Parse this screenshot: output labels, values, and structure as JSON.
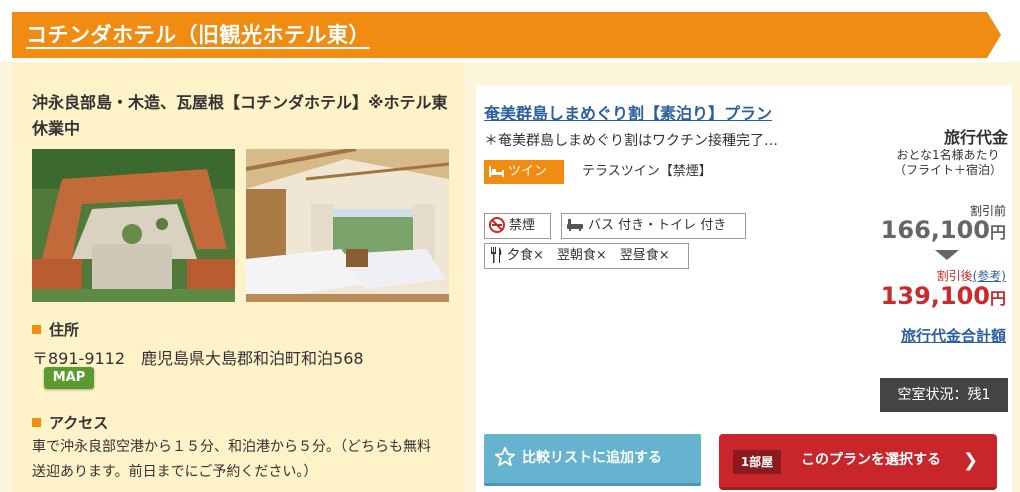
{
  "header": {
    "title": "コチンダホテル（旧観光ホテル東）"
  },
  "hotel": {
    "name": "沖永良部島・木造、瓦屋根【コチンダホテル】※ホテル東休業中",
    "address_heading": "住所",
    "address": "〒891-9112　鹿児島県大島郡和泊町和泊568",
    "map_label": "MAP",
    "access_heading": "アクセス",
    "access": "車で沖永良部空港から１５分、和泊港から５分。（どちらも無料送迎あります。前日までにご予約ください。）"
  },
  "plan": {
    "title": "奄美群島しまめぐり割【素泊り】プラン",
    "description": "＊奄美群島しまめぐり割はワクチン接種完了…",
    "room_badge": "ツイン",
    "room_type": "テラスツイン【禁煙】",
    "tags": {
      "smoking": "禁煙",
      "bath": "バス 付き・トイレ 付き",
      "meals": "夕食×　翌朝食×　翌昼食×"
    }
  },
  "price": {
    "heading": "旅行代金",
    "sub_line1": "おとな1名様あたり",
    "sub_line2": "（フライト＋宿泊）",
    "before_label": "割引前",
    "before_value": "166,100",
    "after_label": "割引後",
    "after_ref": "(参考)",
    "after_value": "139,100",
    "yen": "円",
    "total_link": "旅行代金合計額"
  },
  "vacancy": "空室状況：残1",
  "buttons": {
    "compare": "比較リストに追加する",
    "room_qty": "1部屋",
    "select": "このプランを選択する",
    "chevron": "❯"
  },
  "colors": {
    "accent_orange": "#f08c12",
    "link_blue": "#2a5fa0",
    "price_red": "#cc2a2a",
    "compare_blue": "#66b3cf",
    "select_red": "#c8262b"
  }
}
